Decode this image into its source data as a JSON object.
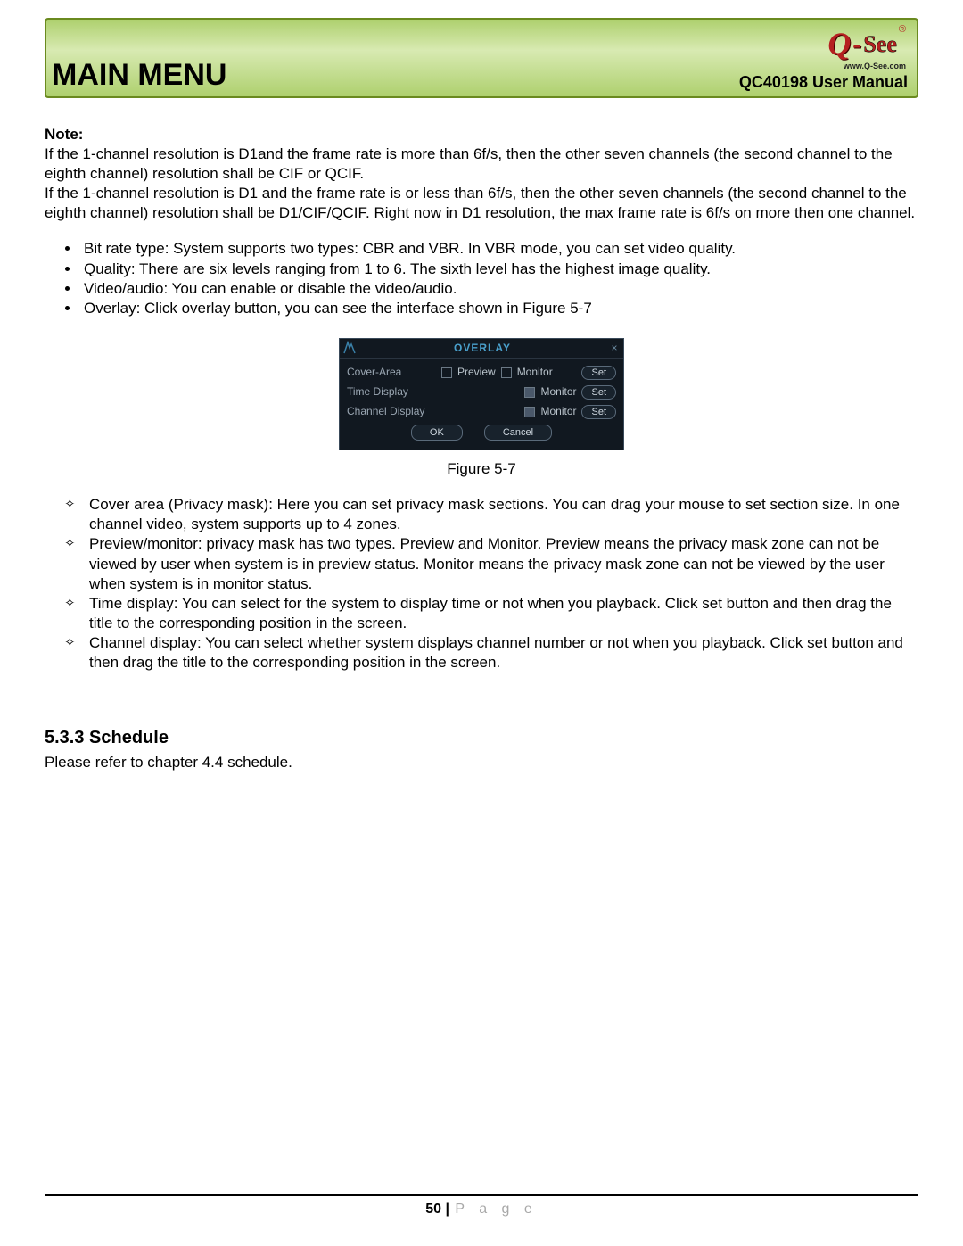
{
  "header": {
    "title": "MAIN MENU",
    "doc_label": "QC40198 User Manual",
    "logo_q": "Q",
    "logo_dash": "-",
    "logo_see": "See",
    "logo_trademark": "®",
    "logo_url": "www.Q-See.com"
  },
  "note": {
    "label": "Note:",
    "p1": "If the 1-channel resolution is D1and the frame rate is more than 6f/s, then the other seven channels (the second channel to the eighth channel) resolution shall be CIF or QCIF.",
    "p2": "If the 1-channel resolution is D1 and the frame rate is or less than 6f/s, then the other seven channels (the second channel to the eighth channel) resolution shall be D1/CIF/QCIF. Right now in D1 resolution, the max frame rate is 6f/s on more then one channel."
  },
  "bullets": [
    "Bit rate type: System supports two types: CBR and VBR. In VBR mode, you can set video quality.",
    "Quality: There are six levels ranging from 1 to 6. The sixth level has the highest image quality.",
    "Video/audio: You can enable or disable the video/audio.",
    "Overlay: Click overlay button, you can see the interface shown in Figure 5-7"
  ],
  "overlay": {
    "title": "OVERLAY",
    "rows": {
      "cover": {
        "label": "Cover-Area",
        "preview": "Preview",
        "monitor": "Monitor",
        "set": "Set"
      },
      "time": {
        "label": "Time Display",
        "monitor": "Monitor",
        "set": "Set"
      },
      "chan": {
        "label": "Channel Display",
        "monitor": "Monitor",
        "set": "Set"
      }
    },
    "ok": "OK",
    "cancel": "Cancel"
  },
  "figure_caption": "Figure 5-7",
  "diamonds": [
    "Cover area (Privacy mask): Here you can set privacy mask sections. You can drag your mouse to set section size. In one channel video, system supports up to 4 zones.",
    "Preview/monitor: privacy mask has two types. Preview and Monitor. Preview means the privacy mask zone can not be viewed by user when system is in preview status. Monitor means the privacy mask zone can not be viewed by the user when system is in monitor status.",
    "Time display: You can select for the system to display time or not when you playback. Click set button and then drag the title to the corresponding position in the screen.",
    "Channel display: You can select whether system displays channel number or not when you playback. Click set button and then drag the title to the corresponding position in the screen."
  ],
  "section": {
    "heading": "5.3.3  Schedule",
    "body": "Please refer to chapter 4.4 schedule."
  },
  "footer": {
    "page_num": "50",
    "sep": " | ",
    "page_word": "P a g e"
  }
}
